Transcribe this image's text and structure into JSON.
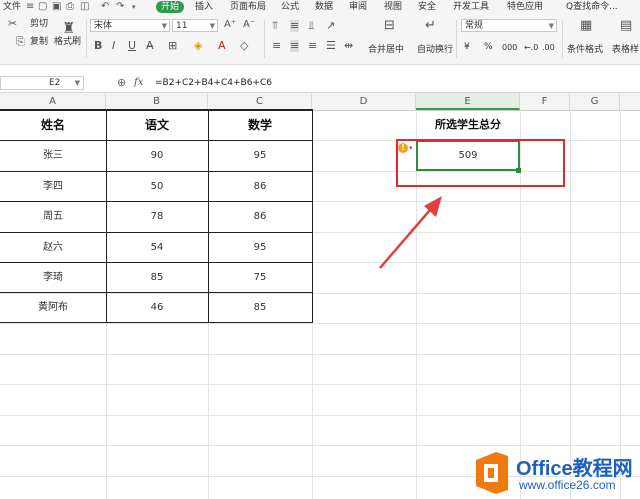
{
  "menu": {
    "file": "文件",
    "tabs": [
      "开始",
      "插入",
      "页面布局",
      "公式",
      "数据",
      "审阅",
      "视图",
      "安全",
      "开发工具",
      "特色应用"
    ],
    "search": "Q查找命令..."
  },
  "ribbon": {
    "cut": "剪切",
    "copy": "复制",
    "format_painter": "格式刷",
    "font_name": "宋体",
    "font_size": "11",
    "merge_center": "合并居中",
    "wrap_text": "自动换行",
    "number_format": "常规",
    "currency_symbol": "¥",
    "percent_symbol": "%",
    "thousands_symbol": "000",
    "conditional_format": "条件格式",
    "table_style": "表格样"
  },
  "formula_bar": {
    "name_box": "E2",
    "fx": "fx",
    "formula": "=B2+C2+B4+C4+B6+C6"
  },
  "columns": [
    "A",
    "B",
    "C",
    "D",
    "E",
    "F",
    "G"
  ],
  "table": {
    "headers": [
      "姓名",
      "语文",
      "数学"
    ],
    "rows": [
      [
        "张三",
        "90",
        "95"
      ],
      [
        "李四",
        "50",
        "86"
      ],
      [
        "周五",
        "78",
        "86"
      ],
      [
        "赵六",
        "54",
        "95"
      ],
      [
        "李琦",
        "85",
        "75"
      ],
      [
        "黄阿布",
        "46",
        "85"
      ]
    ]
  },
  "summary": {
    "label": "所选学生总分",
    "value": "509"
  },
  "watermark": {
    "brand": "Office教程网",
    "url": "www.office26.com"
  },
  "colors": {
    "accent": "#2f9a4a",
    "highlight_box": "#e02a2a",
    "arrow": "#e04040",
    "logo_orange": "#f07a10",
    "logo_blue": "#1f5fbf"
  }
}
